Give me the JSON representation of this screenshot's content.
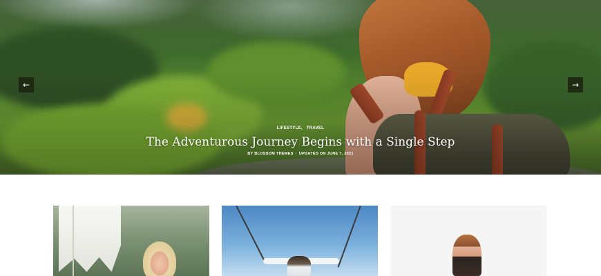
{
  "slider": {
    "categories": [
      "LIFESTYLE,",
      "TRAVEL"
    ],
    "title": "The Adventurous Journey Begins with a Single Step",
    "meta": {
      "author": "BY BLOSSOM THEMES",
      "separator": "·",
      "updated": "UPDATED ON JUNE 7, 2021"
    },
    "prev_icon": "←",
    "next_icon": "→"
  },
  "cards": [
    {
      "image": "woman-with-umbrella-photo"
    },
    {
      "image": "person-on-swing-photo"
    },
    {
      "image": "woman-back-view-photo"
    }
  ],
  "colors": {
    "nav_button_bg": "#1e2a12",
    "caption_text": "#ffffff",
    "page_bg": "#ffffff"
  }
}
